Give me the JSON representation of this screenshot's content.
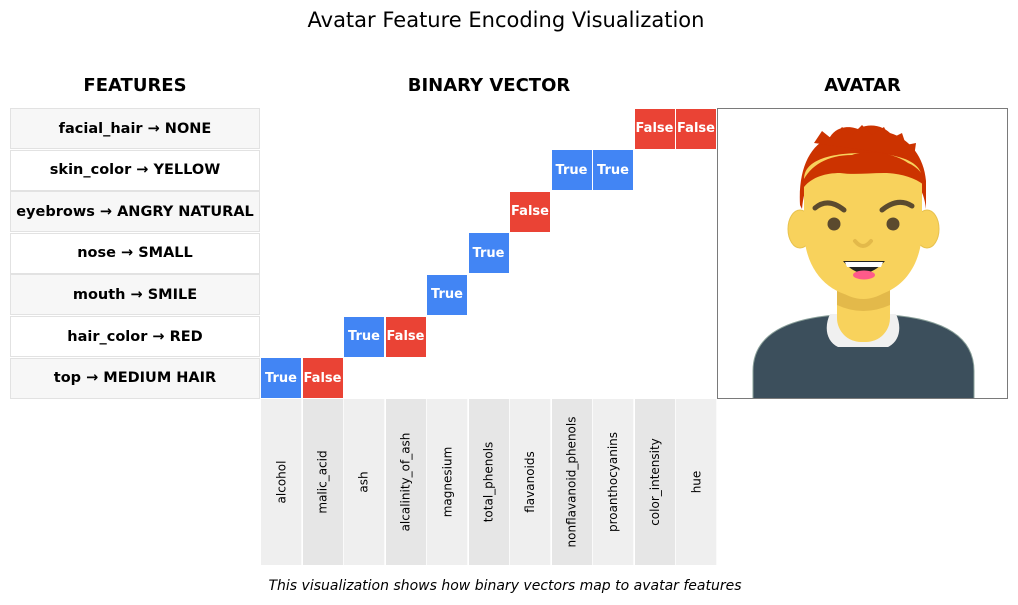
{
  "title": "Avatar Feature Encoding Visualization",
  "headings": {
    "features": "FEATURES",
    "binary_vector": "BINARY VECTOR",
    "avatar": "AVATAR"
  },
  "features": [
    {
      "label": "facial_hair → NONE"
    },
    {
      "label": "skin_color → YELLOW"
    },
    {
      "label": "eyebrows → ANGRY NATURAL"
    },
    {
      "label": "nose → SMALL"
    },
    {
      "label": "mouth → SMILE"
    },
    {
      "label": "hair_color → RED"
    },
    {
      "label": "top → MEDIUM HAIR"
    }
  ],
  "columns": [
    "alcohol",
    "malic_acid",
    "ash",
    "alcalinity_of_ash",
    "magnesium",
    "total_phenols",
    "flavanoids",
    "nonflavanoid_phenols",
    "proanthocyanins",
    "color_intensity",
    "hue"
  ],
  "cells": [
    {
      "row": 0,
      "col": 9,
      "label": "False"
    },
    {
      "row": 0,
      "col": 10,
      "label": "False"
    },
    {
      "row": 1,
      "col": 7,
      "label": "True"
    },
    {
      "row": 1,
      "col": 8,
      "label": "True"
    },
    {
      "row": 2,
      "col": 6,
      "label": "False"
    },
    {
      "row": 3,
      "col": 5,
      "label": "True"
    },
    {
      "row": 4,
      "col": 4,
      "label": "True"
    },
    {
      "row": 5,
      "col": 2,
      "label": "True"
    },
    {
      "row": 5,
      "col": 3,
      "label": "False"
    },
    {
      "row": 6,
      "col": 0,
      "label": "True"
    },
    {
      "row": 6,
      "col": 1,
      "label": "False"
    }
  ],
  "colors": {
    "true": "#4285f4",
    "false": "#ea4335",
    "hair": "#cc3300",
    "skin": "#f8d25c",
    "shirt": "#3c4f5c",
    "eyes": "#5b4a2e"
  },
  "caption": "This visualization shows how binary vectors map to avatar features"
}
